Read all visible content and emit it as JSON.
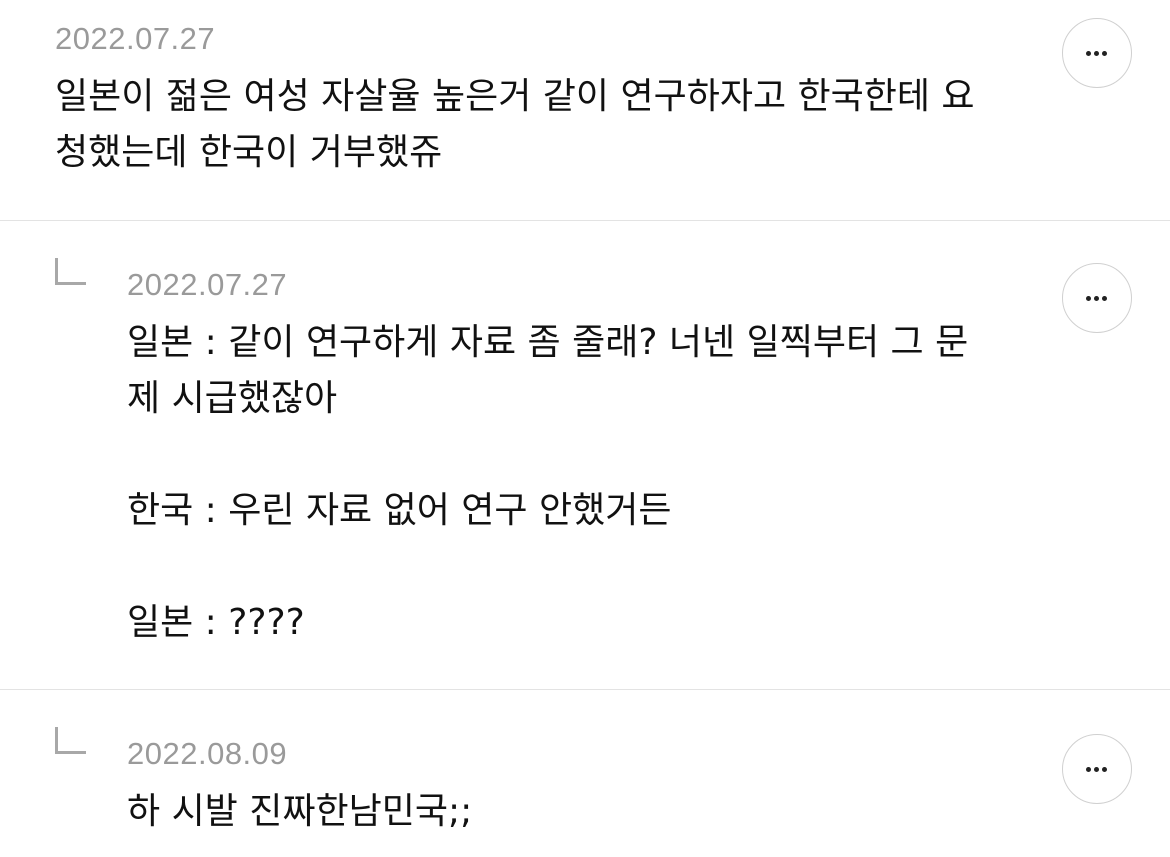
{
  "comments": [
    {
      "date": "2022.07.27",
      "text": "일본이 젊은 여성 자살율 높은거 같이 연구하자고 한국한테 요\n청했는데 한국이 거부했쥬",
      "more_icon": "more-horizontal-icon"
    },
    {
      "date": "2022.07.27",
      "text": "일본 : 같이 연구하게 자료 좀 줄래? 너넨 일찍부터 그 문\n제 시급했잖아\n\n한국 : 우린 자료 없어 연구 안했거든\n\n일본 : ????",
      "reply_icon": "reply-arrow-icon",
      "more_icon": "more-horizontal-icon"
    },
    {
      "date": "2022.08.09",
      "text": "하 시발 진짜한남민국;;",
      "reply_icon": "reply-arrow-icon",
      "more_icon": "more-horizontal-icon"
    }
  ]
}
